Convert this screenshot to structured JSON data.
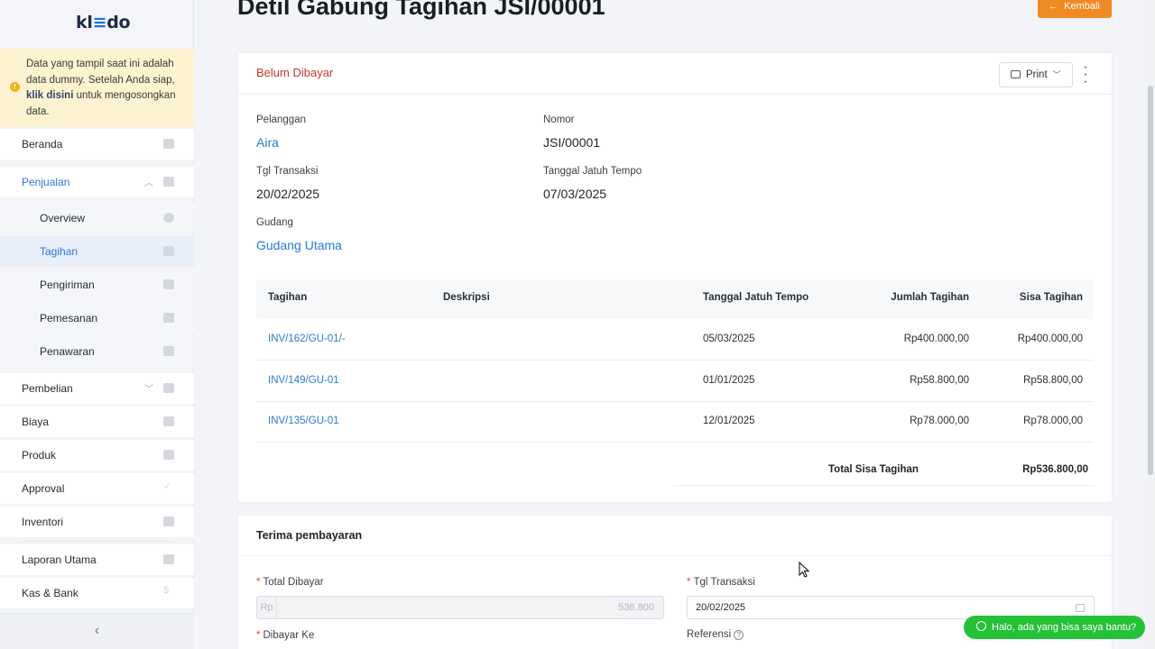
{
  "sidebar": {
    "logo_prefix": "kl",
    "logo_e": "≡",
    "logo_suffix": "do",
    "notice": {
      "text_before": "Data yang tampil saat ini adalah data dummy. Setelah Anda siap, ",
      "link": "klik disini",
      "text_after": " untuk mengosongkan data."
    },
    "items": [
      {
        "label": "Beranda",
        "icon": "home-icon"
      },
      {
        "label": "Penjualan",
        "icon": "basket-icon"
      },
      {
        "label": "Overview",
        "icon": "pie-icon"
      },
      {
        "label": "Tagihan",
        "icon": "tag-icon"
      },
      {
        "label": "Pengiriman",
        "icon": "tag-icon"
      },
      {
        "label": "Pemesanan",
        "icon": "tag-icon"
      },
      {
        "label": "Penawaran",
        "icon": "tag-icon"
      },
      {
        "label": "Pembelian",
        "icon": "bag-icon"
      },
      {
        "label": "Biaya",
        "icon": "card-icon"
      },
      {
        "label": "Produk",
        "icon": "box-icon"
      },
      {
        "label": "Approval",
        "icon": "check-icon"
      },
      {
        "label": "Inventori",
        "icon": "warehouse-icon"
      },
      {
        "label": "Laporan Utama",
        "icon": "chart-icon"
      },
      {
        "label": "Kas & Bank",
        "icon": "dollar-icon"
      }
    ],
    "collapse_label": "‹"
  },
  "header": {
    "title": "Detil Gabung Tagihan JSI/00001",
    "back_button": "Kembali",
    "back_arrow": "←"
  },
  "invoice": {
    "status": "Belum Dibayar",
    "print_label": "Print",
    "fields": {
      "pelanggan_label": "Pelanggan",
      "pelanggan": "Aira",
      "nomor_label": "Nomor",
      "nomor": "JSI/00001",
      "tgl_label": "Tgl Transaksi",
      "tgl": "20/02/2025",
      "jatuh_tempo_label": "Tanggal Jatuh Tempo",
      "jatuh_tempo": "07/03/2025",
      "gudang_label": "Gudang",
      "gudang": "Gudang Utama"
    },
    "table": {
      "headers": [
        "Tagihan",
        "Deskripsi",
        "Tanggal Jatuh Tempo",
        "Jumlah Tagihan",
        "Sisa Tagihan"
      ],
      "rows": [
        {
          "tagihan": "INV/162/GU-01/-",
          "deskripsi": "",
          "tanggal": "05/03/2025",
          "jumlah": "Rp400.000,00",
          "sisa": "Rp400.000,00"
        },
        {
          "tagihan": "INV/149/GU-01",
          "deskripsi": "",
          "tanggal": "01/01/2025",
          "jumlah": "Rp58.800,00",
          "sisa": "Rp58.800,00"
        },
        {
          "tagihan": "INV/135/GU-01",
          "deskripsi": "",
          "tanggal": "12/01/2025",
          "jumlah": "Rp78.000,00",
          "sisa": "Rp78.000,00"
        }
      ],
      "total_label": "Total Sisa Tagihan",
      "total_value": "Rp536.800,00"
    }
  },
  "payment": {
    "title": "Terima pembayaran",
    "total_label": "Total Dibayar",
    "currency_prefix": "Rp",
    "total_value": "536.800",
    "tgl_label": "Tgl Transaksi",
    "tgl_value": "20/02/2025",
    "dibayar_ke_label": "Dibayar Ke",
    "referensi_label": "Referensi",
    "required_mark": "*",
    "help_mark": "?"
  },
  "chat": {
    "label": "Halo, ada yang bisa saya bantu?"
  },
  "colors": {
    "accent": "#2a78d4",
    "warning_bg": "#fdf3d0",
    "back_button": "#f08a24",
    "status": "#c0392b",
    "chat": "#25c137"
  }
}
